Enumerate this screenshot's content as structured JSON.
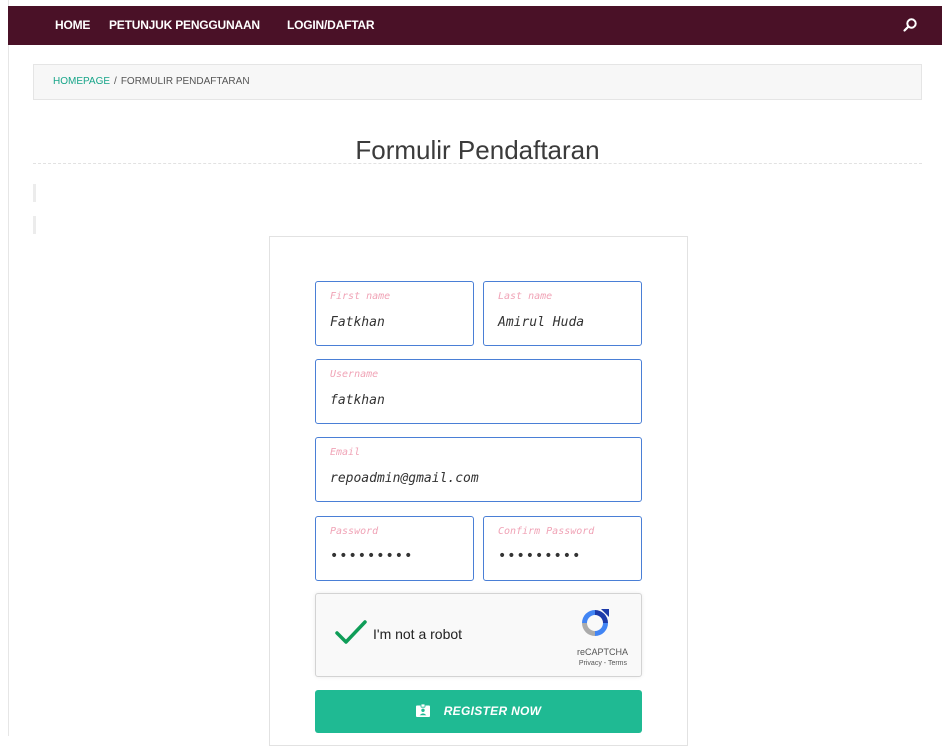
{
  "nav": {
    "items": [
      "HOME",
      "PETUNJUK PENGGUNAAN",
      "LOGIN/DAFTAR"
    ],
    "search_icon": "search-icon",
    "background": "#4a1127"
  },
  "breadcrumb": {
    "home": "HOMEPAGE",
    "separator": "/",
    "current": "FORMULIR PENDAFTARAN"
  },
  "page": {
    "title": "Formulir Pendaftaran"
  },
  "form": {
    "first_name": {
      "label": "First name",
      "value": "Fatkhan"
    },
    "last_name": {
      "label": "Last name",
      "value": "Amirul Huda"
    },
    "username": {
      "label": "Username",
      "value": "fatkhan"
    },
    "email": {
      "label": "Email",
      "value": "repoadmin@gmail.com"
    },
    "password": {
      "label": "Password",
      "value": "•••••••••"
    },
    "confirm_password": {
      "label": "Confirm Password",
      "value": "•••••••••"
    }
  },
  "captcha": {
    "text": "I'm not a robot",
    "brand": "reCAPTCHA",
    "privacy": "Privacy",
    "separator": " - ",
    "terms": "Terms",
    "checked": true
  },
  "register": {
    "label": "REGISTER NOW",
    "icon": "id-card-icon",
    "color": "#1fba93"
  }
}
